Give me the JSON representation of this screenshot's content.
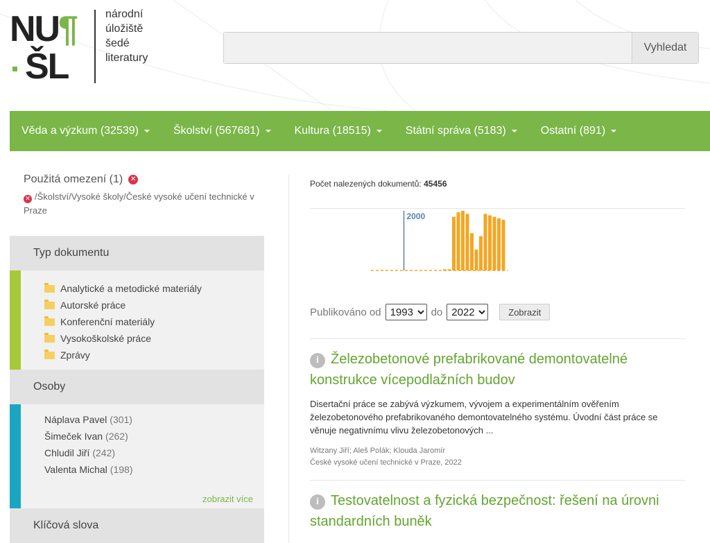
{
  "header": {
    "logo": {
      "mark_nu": "NU",
      "mark_para": "¶",
      "mark_sl": "ŠL",
      "text_lines": [
        "národní",
        "úložiště",
        "šedé",
        "literatury"
      ]
    },
    "search": {
      "value": "",
      "placeholder": "",
      "button_label": "Vyhledat"
    }
  },
  "nav": {
    "items": [
      {
        "label": "Věda a výzkum (32539)"
      },
      {
        "label": "Školství (567681)"
      },
      {
        "label": "Kultura (18515)"
      },
      {
        "label": "Státní správa (5183)"
      },
      {
        "label": "Ostatní (891)"
      }
    ]
  },
  "filters": {
    "title": "Použitá omezení (1)",
    "active": "/Školství/Vysoké školy/České vysoké učení technické v Praze"
  },
  "facets": {
    "doc_type": {
      "title": "Typ dokumentu",
      "items": [
        "Analytické a metodické materiály",
        "Autorské práce",
        "Konferenční materiály",
        "Vysokoškolské práce",
        "Zprávy"
      ]
    },
    "persons": {
      "title": "Osoby",
      "items": [
        {
          "name": "Náplava Pavel",
          "count": "(301)"
        },
        {
          "name": "Šimeček Ivan",
          "count": "(262)"
        },
        {
          "name": "Chludil Jiří",
          "count": "(242)"
        },
        {
          "name": "Valenta Michal",
          "count": "(198)"
        }
      ],
      "show_more": "zobrazit více"
    },
    "keywords": {
      "title": "Klíčová slova"
    }
  },
  "results_count": {
    "label": "Počet nalezených dokumentů:",
    "value": "45456"
  },
  "chart_data": {
    "type": "bar",
    "marker_label": "2000",
    "x": [
      1993,
      1994,
      1995,
      1996,
      1997,
      1998,
      1999,
      2000,
      2001,
      2002,
      2003,
      2004,
      2005,
      2006,
      2007,
      2008,
      2009,
      2010,
      2011,
      2012,
      2013,
      2014,
      2015,
      2016,
      2017,
      2018,
      2019,
      2020,
      2021,
      2022
    ],
    "values": [
      0,
      0,
      0,
      0,
      0,
      0,
      0,
      0,
      0,
      0,
      0,
      0,
      0,
      0,
      0,
      0,
      40,
      40,
      1800,
      1950,
      2000,
      1900,
      1250,
      700,
      1150,
      1900,
      1850,
      1800,
      1750,
      1700
    ],
    "ylim": [
      0,
      2000
    ],
    "color": "#f5a623",
    "marker_color": "#5b7fb0"
  },
  "date_filter": {
    "from_label": "Publikováno od",
    "from_value": "1993",
    "to_label": "do",
    "to_value": "2022",
    "button_label": "Zobrazit"
  },
  "results": [
    {
      "title": "Železobetonové prefabrikované demontovatelné konstrukce vícepodlažních budov",
      "abstract": "Disertační práce se zabývá výzkumem, vývojem a experimentálním ověřením železobetonového prefabrikovaného demontovatelného systému. Úvodní část práce se věnuje negativnímu vlivu železobetonových ...",
      "authors": "Witzany Jiří; Aleš Polák; Klouda Jaromír",
      "publisher": "České vysoké učení technické v Praze, 2022"
    },
    {
      "title": "Testovatelnost a fyzická bezpečnost: řešení na úrovni standardních buněk",
      "abstract": "",
      "authors": "",
      "publisher": ""
    }
  ],
  "colors": {
    "brand_green": "#7ab648",
    "link_green": "#63a52f",
    "facet_doc_type": "#a6c93a",
    "facet_persons": "#1aa6c1",
    "facet_keywords": "#f6bd26"
  }
}
